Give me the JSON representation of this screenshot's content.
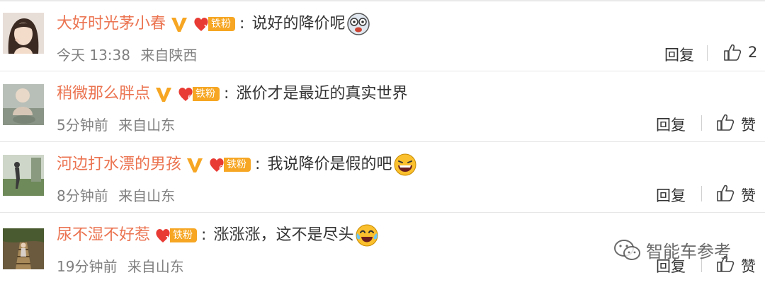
{
  "comments": [
    {
      "username": "大好时光茅小春",
      "verified": true,
      "fan_level": "1",
      "fan_badge": "铁粉",
      "colon": ":",
      "text": "说好的降价呢",
      "emoji": "dizzy-face-emoji",
      "time": "今天 13:38",
      "location": "来自陕西",
      "reply_label": "回复",
      "like_label": "2"
    },
    {
      "username": "稍微那么胖点",
      "verified": true,
      "fan_level": "6",
      "fan_badge": "铁粉",
      "colon": ":",
      "text": "涨价才是最近的真实世界",
      "emoji": "",
      "time": "5分钟前",
      "location": "来自山东",
      "reply_label": "回复",
      "like_label": "赞"
    },
    {
      "username": "河边打水漂的男孩",
      "verified": true,
      "fan_level": "6",
      "fan_badge": "铁粉",
      "colon": ":",
      "text": "我说降价是假的吧",
      "emoji": "laughing-face-emoji",
      "time": "8分钟前",
      "location": "来自山东",
      "reply_label": "回复",
      "like_label": "赞"
    },
    {
      "username": "尿不湿不好惹",
      "verified": false,
      "fan_level": "1",
      "fan_badge": "铁粉",
      "colon": ":",
      "text": "涨涨涨，这不是尽头",
      "emoji": "crying-laughing-emoji",
      "time": "19分钟前",
      "location": "来自山东",
      "reply_label": "回复",
      "like_label": "赞"
    }
  ],
  "watermark": {
    "text": "智能车参考",
    "icon": "wechat-icon"
  },
  "colors": {
    "username": "#eb7350",
    "fan_badge": "#f6a623",
    "verified": "#f6a623",
    "meta": "#808080"
  }
}
